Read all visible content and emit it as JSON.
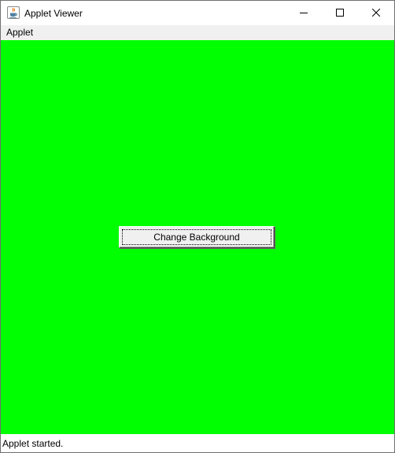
{
  "window": {
    "title": "Applet Viewer",
    "icon": "java-icon",
    "controls": {
      "minimize_icon": "minimize-icon",
      "maximize_icon": "maximize-icon",
      "close_icon": "close-icon"
    }
  },
  "menubar": {
    "items": [
      {
        "label": "Applet"
      }
    ]
  },
  "applet": {
    "background_color": "#00ff00",
    "button_label": "Change Background"
  },
  "status": {
    "text": "Applet started."
  }
}
